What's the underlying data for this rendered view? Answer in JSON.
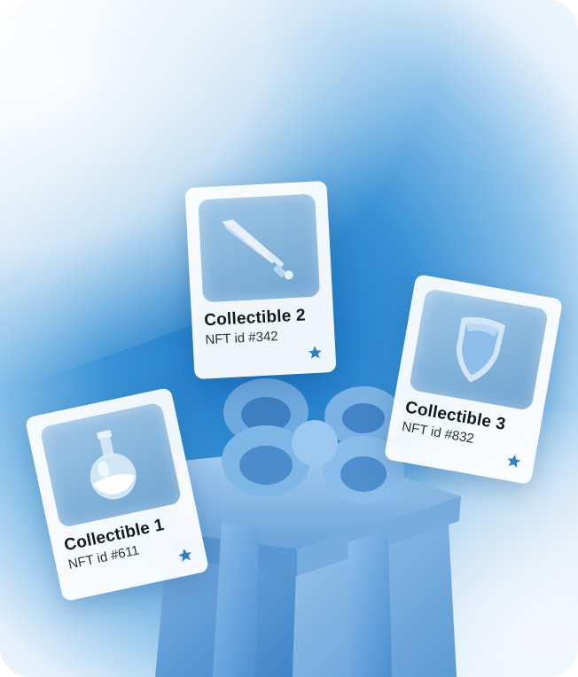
{
  "cards": [
    {
      "title": "Collectible 1",
      "nft_id": "NFT id #611",
      "art_icon": "potion-flask-icon",
      "badge_icon": "star-icon"
    },
    {
      "title": "Collectible 2",
      "nft_id": "NFT id #342",
      "art_icon": "sword-icon",
      "badge_icon": "star-icon"
    },
    {
      "title": "Collectible 3",
      "nft_id": "NFT id #832",
      "art_icon": "shield-icon",
      "badge_icon": "star-icon"
    }
  ],
  "colors": {
    "accent": "#2f7fc4",
    "gift_blue": "#5a9bd6",
    "background_blue": "#1674c2"
  }
}
